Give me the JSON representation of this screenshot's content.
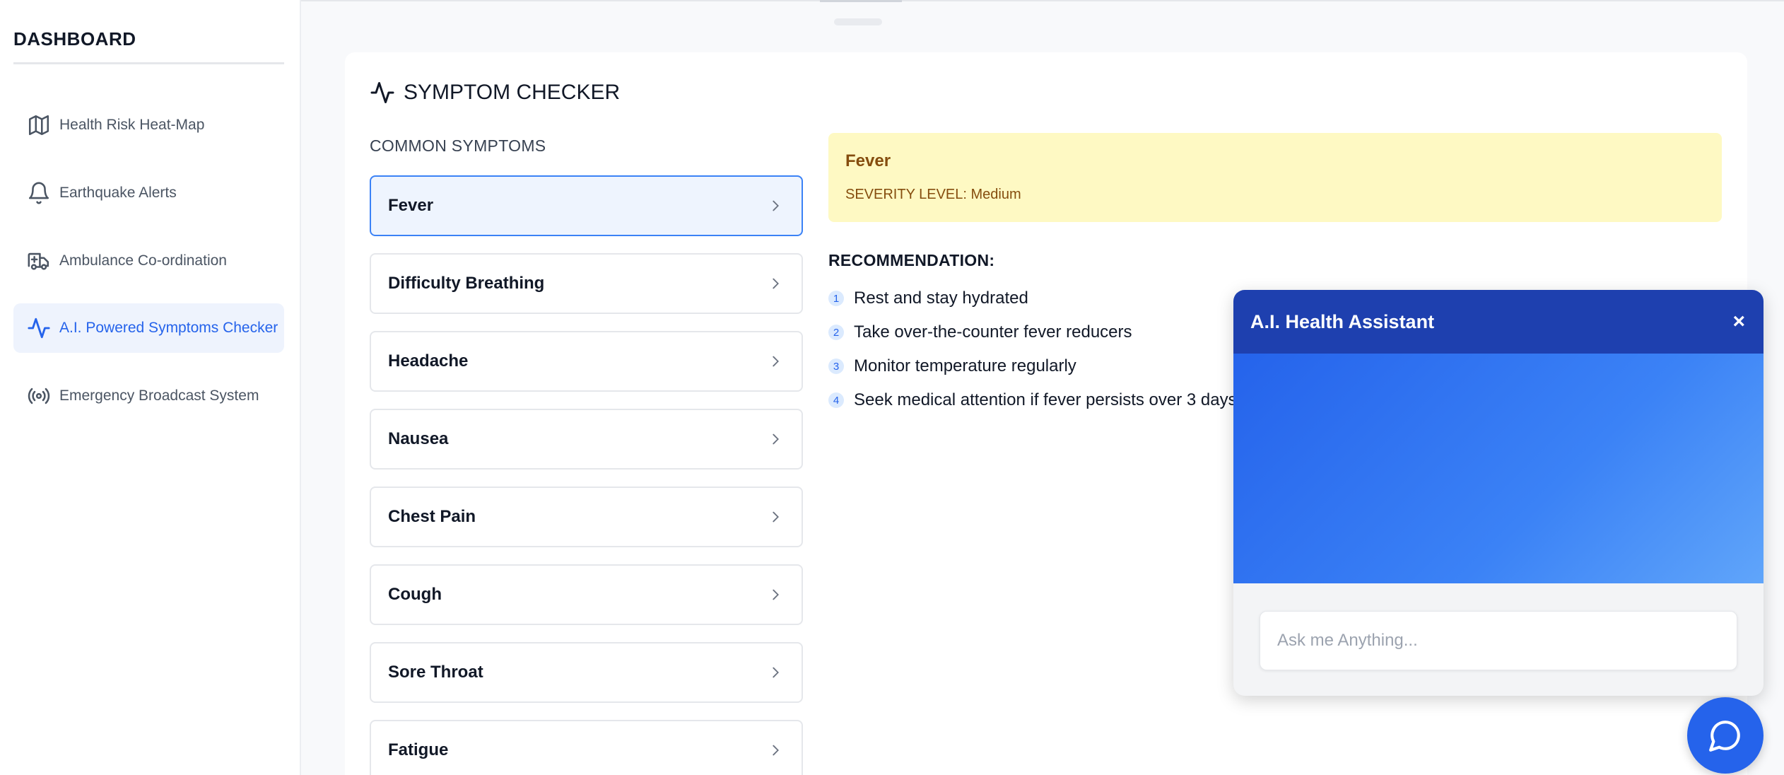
{
  "sidebar": {
    "title": "DASHBOARD",
    "items": [
      {
        "label": "Health Risk Heat-Map",
        "icon": "map-icon"
      },
      {
        "label": "Earthquake Alerts",
        "icon": "bell-icon"
      },
      {
        "label": "Ambulance Co-ordination",
        "icon": "ambulance-icon"
      },
      {
        "label": "A.I. Powered Symptoms Checker",
        "icon": "activity-icon",
        "active": true
      },
      {
        "label": "Emergency Broadcast System",
        "icon": "broadcast-icon"
      }
    ]
  },
  "checker": {
    "title": "SYMPTOM CHECKER",
    "common_label": "COMMON SYMPTOMS",
    "symptoms": [
      "Fever",
      "Difficulty Breathing",
      "Headache",
      "Nausea",
      "Chest Pain",
      "Cough",
      "Sore Throat",
      "Fatigue"
    ],
    "selected": "Fever"
  },
  "result": {
    "name": "Fever",
    "severity": "SEVERITY LEVEL: Medium",
    "recommendation_title": "RECOMMENDATION:",
    "recommendations": [
      {
        "num": "1",
        "text": "Rest and stay hydrated"
      },
      {
        "num": "2",
        "text": "Take over-the-counter fever reducers"
      },
      {
        "num": "3",
        "text": "Monitor temperature regularly"
      },
      {
        "num": "4",
        "text": "Seek medical attention if fever persists over 3 days"
      }
    ]
  },
  "chat": {
    "title": "A.I. Health Assistant",
    "close": "×",
    "placeholder": "Ask me Anything..."
  },
  "colors": {
    "accent": "#2563eb",
    "chat_header": "#1e40af",
    "severity_bg": "#fef9c3",
    "severity_text": "#854d0e"
  }
}
